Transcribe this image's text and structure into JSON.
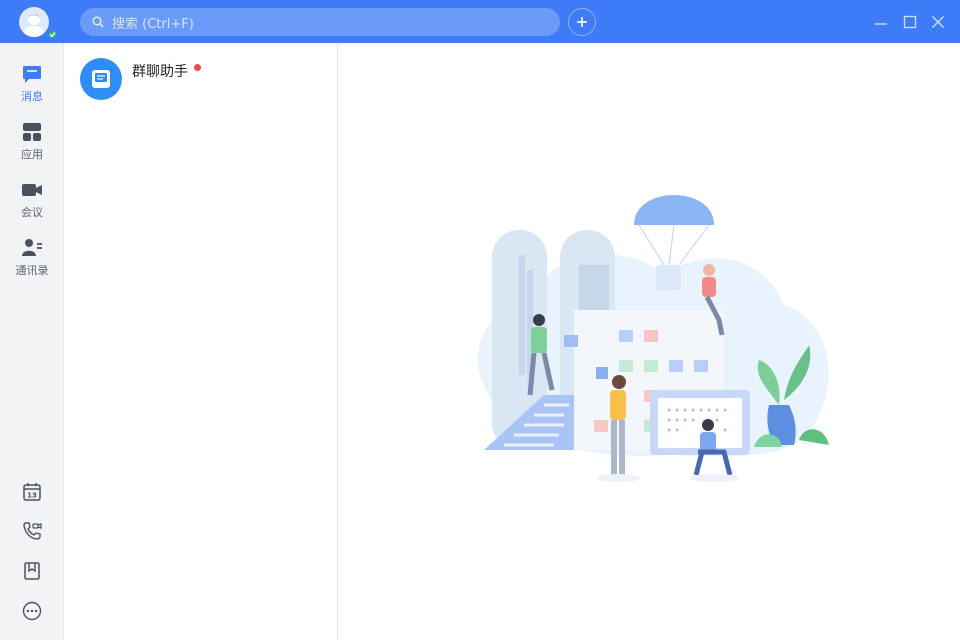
{
  "titlebar": {
    "search": {
      "placeholder": "搜索 (Ctrl+F)",
      "icon": "search-icon"
    },
    "add_button": {
      "icon": "plus-icon"
    },
    "window_controls": [
      "minimize-icon",
      "maximize-icon",
      "close-icon"
    ],
    "user_status": "online"
  },
  "sidebar": {
    "items": [
      {
        "label": "消息",
        "icon": "message-icon",
        "active": true
      },
      {
        "label": "应用",
        "icon": "apps-icon",
        "active": false
      },
      {
        "label": "会议",
        "icon": "video-camera-icon",
        "active": false
      },
      {
        "label": "通讯录",
        "icon": "contacts-icon",
        "active": false
      }
    ],
    "bottom_icons": [
      {
        "icon": "calendar-icon",
        "text": "13"
      },
      {
        "icon": "phone-video-icon"
      },
      {
        "icon": "bookmark-icon"
      },
      {
        "icon": "more-icon"
      }
    ]
  },
  "conversations": [
    {
      "name": "群聊助手",
      "icon": "group-assistant-icon",
      "unread": true
    }
  ],
  "colors": {
    "accent": "#3d7cf6",
    "sidebar_bg": "#f2f3f5",
    "unread": "#f04b4b",
    "online": "#2cbf5a"
  }
}
